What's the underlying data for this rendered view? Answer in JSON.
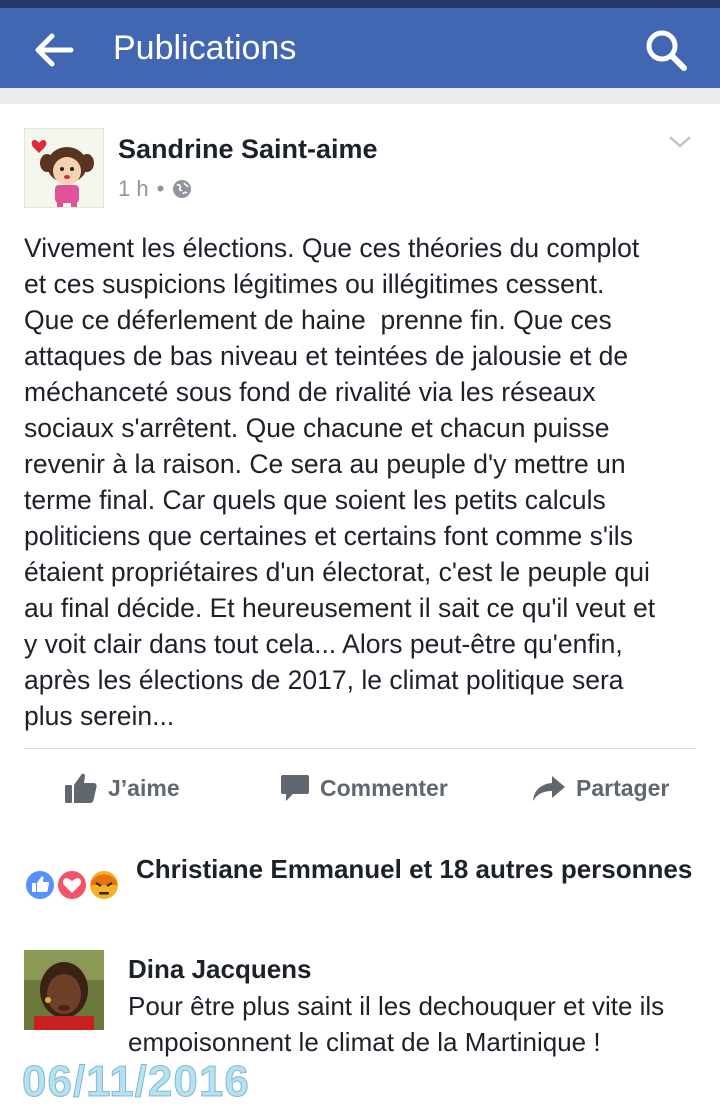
{
  "header": {
    "title": "Publications",
    "back_icon": "arrow-left-icon",
    "search_icon": "search-icon",
    "background": "#4267b2"
  },
  "post": {
    "author": "Sandrine Saint-aime",
    "time": "1 h",
    "separator": "•",
    "privacy_icon": "globe-icon",
    "menu_icon": "chevron-down-icon",
    "text": "Vivement les élections. Que ces théories du complot\net ces suspicions légitimes ou illégitimes cessent.\nQue ce déferlement de haine  prenne fin. Que ces\nattaques de bas niveau et teintées de jalousie et de\nméchanceté sous fond de rivalité via les réseaux\nsociaux s'arrêtent. Que chacune et chacun puisse\nrevenir à la raison. Ce sera au peuple d'y mettre un\nterme final. Car quels que soient les petits calculs\npoliticiens que certaines et certains font comme s'ils\nétaient propriétaires d'un électorat, c'est le peuple qui\nau final décide. Et heureusement il sait ce qu'il veut et\ny voit clair dans tout cela... Alors peut-être qu'enfin,\naprès les élections de 2017, le climat politique sera\nplus serein..."
  },
  "actions": {
    "like": "J’aime",
    "comment": "Commenter",
    "share": "Partager"
  },
  "reactions": {
    "summary": "Christiane Emmanuel et 18 autres personnes",
    "icons": [
      "like-icon",
      "love-icon",
      "angry-icon"
    ]
  },
  "comment": {
    "author": "Dina Jacquens",
    "text": "Pour être plus saint il les dechouquer et vite ils empoisonnent le climat de la Martinique !"
  },
  "watermark": {
    "date": "06/11/2016"
  }
}
